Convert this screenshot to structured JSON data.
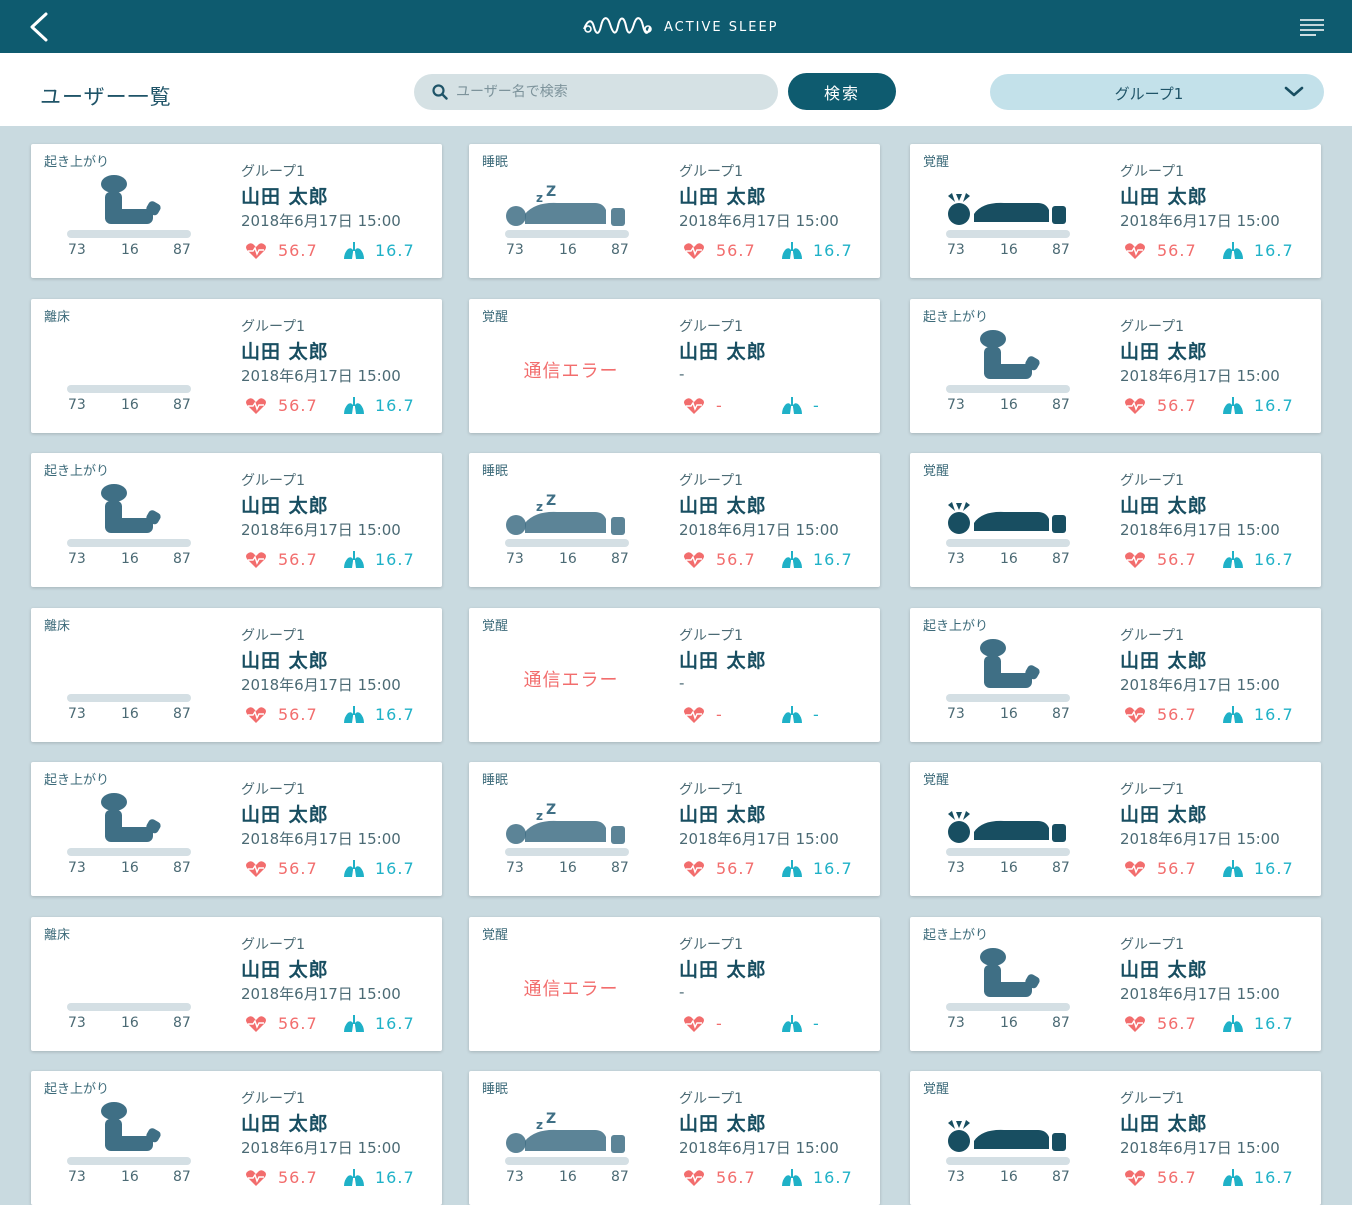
{
  "app": {
    "brand": "ACTIVE SLEEP"
  },
  "toolbar": {
    "title": "ユーザー一覧",
    "search_placeholder": "ユーザー名で検索",
    "search_button": "検索",
    "group_selected": "グループ1"
  },
  "colors": {
    "header": "#0e5b6f",
    "figure": "#3f6f85",
    "error": "#f26d6d",
    "heart": "#f26d6d",
    "lung": "#1fb1c7"
  },
  "cards": [
    {
      "status": "起き上がり",
      "figure": "sitting-icon",
      "group": "グループ1",
      "name": "山田 太郎",
      "time": "2018年6月17日 15:00",
      "stats": [
        "73",
        "16",
        "87"
      ],
      "heart": "56.7",
      "breath": "16.7"
    },
    {
      "status": "睡眠",
      "figure": "sleeping-icon",
      "group": "グループ1",
      "name": "山田 太郎",
      "time": "2018年6月17日 15:00",
      "stats": [
        "73",
        "16",
        "87"
      ],
      "heart": "56.7",
      "breath": "16.7"
    },
    {
      "status": "覚醒",
      "figure": "awake-icon",
      "group": "グループ1",
      "name": "山田 太郎",
      "time": "2018年6月17日 15:00",
      "stats": [
        "73",
        "16",
        "87"
      ],
      "heart": "56.7",
      "breath": "16.7"
    },
    {
      "status": "離床",
      "figure": "empty-bed-icon",
      "group": "グループ1",
      "name": "山田 太郎",
      "time": "2018年6月17日 15:00",
      "stats": [
        "73",
        "16",
        "87"
      ],
      "heart": "56.7",
      "breath": "16.7"
    },
    {
      "status": "覚醒",
      "figure": "error",
      "error": "通信エラー",
      "group": "グループ1",
      "name": "山田 太郎",
      "time": "-",
      "stats": [],
      "heart": "-",
      "breath": "-"
    },
    {
      "status": "起き上がり",
      "figure": "sitting-icon",
      "group": "グループ1",
      "name": "山田 太郎",
      "time": "2018年6月17日 15:00",
      "stats": [
        "73",
        "16",
        "87"
      ],
      "heart": "56.7",
      "breath": "16.7"
    },
    {
      "status": "起き上がり",
      "figure": "sitting-icon",
      "group": "グループ1",
      "name": "山田 太郎",
      "time": "2018年6月17日 15:00",
      "stats": [
        "73",
        "16",
        "87"
      ],
      "heart": "56.7",
      "breath": "16.7"
    },
    {
      "status": "睡眠",
      "figure": "sleeping-icon",
      "group": "グループ1",
      "name": "山田 太郎",
      "time": "2018年6月17日 15:00",
      "stats": [
        "73",
        "16",
        "87"
      ],
      "heart": "56.7",
      "breath": "16.7"
    },
    {
      "status": "覚醒",
      "figure": "awake-icon",
      "group": "グループ1",
      "name": "山田 太郎",
      "time": "2018年6月17日 15:00",
      "stats": [
        "73",
        "16",
        "87"
      ],
      "heart": "56.7",
      "breath": "16.7"
    },
    {
      "status": "離床",
      "figure": "empty-bed-icon",
      "group": "グループ1",
      "name": "山田 太郎",
      "time": "2018年6月17日 15:00",
      "stats": [
        "73",
        "16",
        "87"
      ],
      "heart": "56.7",
      "breath": "16.7"
    },
    {
      "status": "覚醒",
      "figure": "error",
      "error": "通信エラー",
      "group": "グループ1",
      "name": "山田 太郎",
      "time": "-",
      "stats": [],
      "heart": "-",
      "breath": "-"
    },
    {
      "status": "起き上がり",
      "figure": "sitting-icon",
      "group": "グループ1",
      "name": "山田 太郎",
      "time": "2018年6月17日 15:00",
      "stats": [
        "73",
        "16",
        "87"
      ],
      "heart": "56.7",
      "breath": "16.7"
    },
    {
      "status": "起き上がり",
      "figure": "sitting-icon",
      "group": "グループ1",
      "name": "山田 太郎",
      "time": "2018年6月17日 15:00",
      "stats": [
        "73",
        "16",
        "87"
      ],
      "heart": "56.7",
      "breath": "16.7"
    },
    {
      "status": "睡眠",
      "figure": "sleeping-icon",
      "group": "グループ1",
      "name": "山田 太郎",
      "time": "2018年6月17日 15:00",
      "stats": [
        "73",
        "16",
        "87"
      ],
      "heart": "56.7",
      "breath": "16.7"
    },
    {
      "status": "覚醒",
      "figure": "awake-icon",
      "group": "グループ1",
      "name": "山田 太郎",
      "time": "2018年6月17日 15:00",
      "stats": [
        "73",
        "16",
        "87"
      ],
      "heart": "56.7",
      "breath": "16.7"
    },
    {
      "status": "離床",
      "figure": "empty-bed-icon",
      "group": "グループ1",
      "name": "山田 太郎",
      "time": "2018年6月17日 15:00",
      "stats": [
        "73",
        "16",
        "87"
      ],
      "heart": "56.7",
      "breath": "16.7"
    },
    {
      "status": "覚醒",
      "figure": "error",
      "error": "通信エラー",
      "group": "グループ1",
      "name": "山田 太郎",
      "time": "-",
      "stats": [],
      "heart": "-",
      "breath": "-"
    },
    {
      "status": "起き上がり",
      "figure": "sitting-icon",
      "group": "グループ1",
      "name": "山田 太郎",
      "time": "2018年6月17日 15:00",
      "stats": [
        "73",
        "16",
        "87"
      ],
      "heart": "56.7",
      "breath": "16.7"
    },
    {
      "status": "起き上がり",
      "figure": "sitting-icon",
      "group": "グループ1",
      "name": "山田 太郎",
      "time": "2018年6月17日 15:00",
      "stats": [
        "73",
        "16",
        "87"
      ],
      "heart": "56.7",
      "breath": "16.7"
    },
    {
      "status": "睡眠",
      "figure": "sleeping-icon",
      "group": "グループ1",
      "name": "山田 太郎",
      "time": "2018年6月17日 15:00",
      "stats": [
        "73",
        "16",
        "87"
      ],
      "heart": "56.7",
      "breath": "16.7"
    },
    {
      "status": "覚醒",
      "figure": "awake-icon",
      "group": "グループ1",
      "name": "山田 太郎",
      "time": "2018年6月17日 15:00",
      "stats": [
        "73",
        "16",
        "87"
      ],
      "heart": "56.7",
      "breath": "16.7"
    }
  ]
}
